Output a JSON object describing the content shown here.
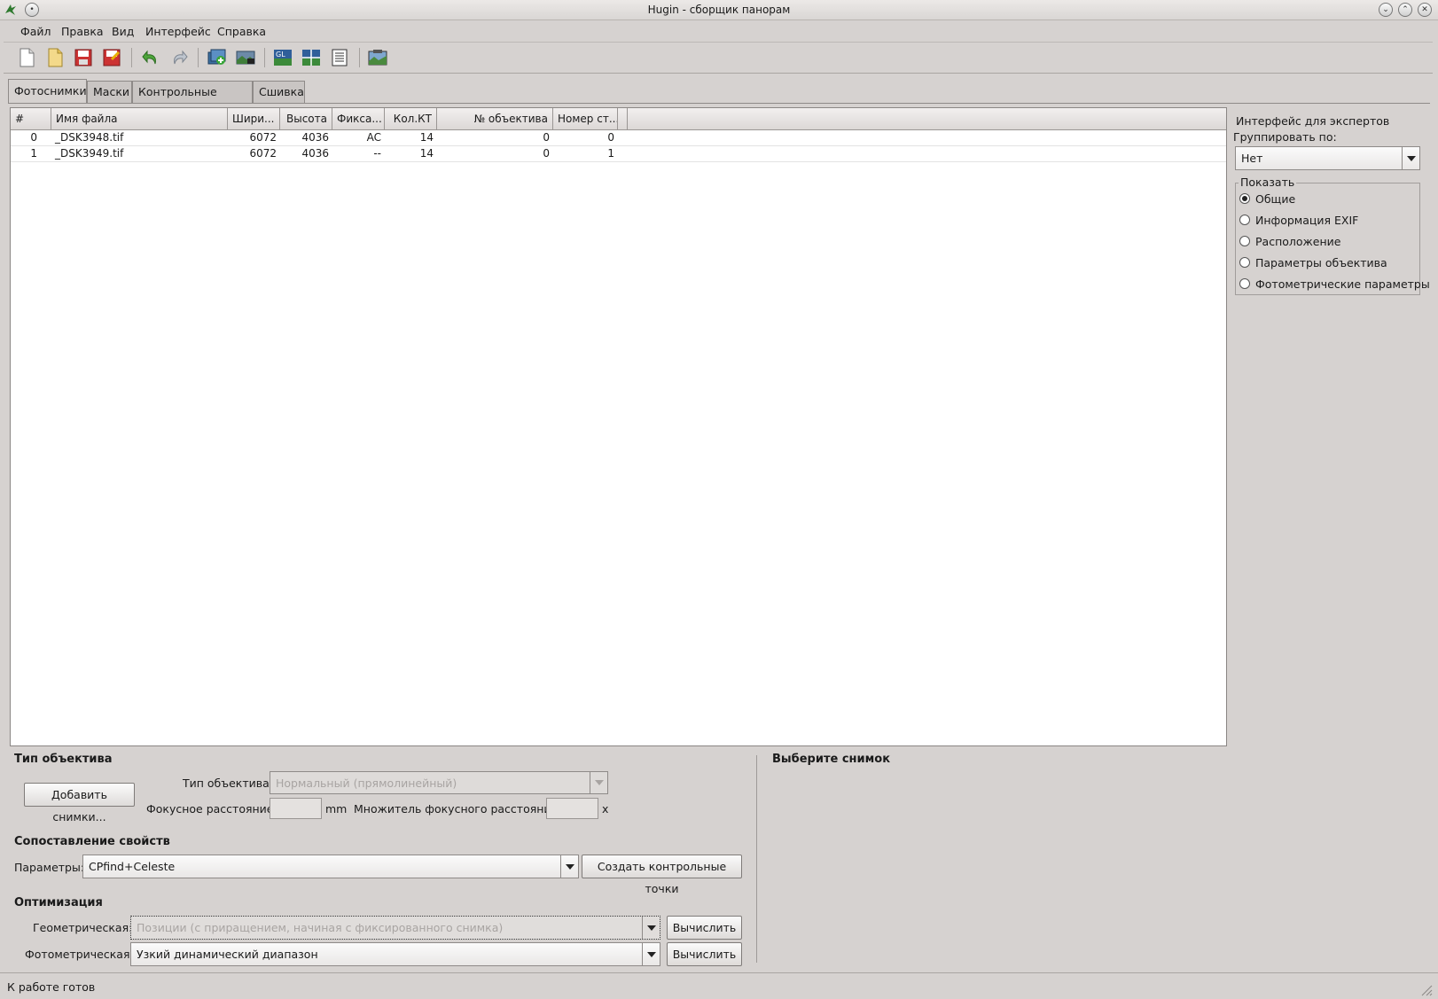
{
  "window": {
    "title": "Hugin - сборщик панорам"
  },
  "menu": [
    {
      "label": "Файл"
    },
    {
      "label": "Правка"
    },
    {
      "label": "Вид"
    },
    {
      "label": "Интерфейс"
    },
    {
      "label": "Справка"
    }
  ],
  "toolbar": {
    "icons": [
      "new-document-icon",
      "open-icon",
      "save-icon",
      "save-as-icon",
      "undo-icon",
      "redo-icon",
      "add-images-icon",
      "assistant-icon",
      "gl-preview-icon",
      "fast-preview-icon",
      "layout-icon",
      "stitch-icon"
    ]
  },
  "tabs": [
    {
      "label": "Фотоснимки",
      "active": true
    },
    {
      "label": "Маски"
    },
    {
      "label": "Контрольные точки"
    },
    {
      "label": "Сшивка"
    }
  ],
  "table": {
    "columns": [
      "#",
      "Имя файла",
      "Шири...",
      "Высота",
      "Фикса...",
      "Кол.КТ",
      "№ объектива",
      "Номер ст..."
    ],
    "rows": [
      [
        "0",
        "_DSK3948.tif",
        "6072",
        "4036",
        "AC",
        "14",
        "0",
        "0"
      ],
      [
        "1",
        "_DSK3949.tif",
        "6072",
        "4036",
        "--",
        "14",
        "0",
        "1"
      ]
    ]
  },
  "right_panel": {
    "expert_label": "Интерфейс для экспертов",
    "group_by_label": "Группировать по:",
    "group_by_value": "Нет",
    "show_label": "Показать",
    "options": [
      {
        "label": "Общие",
        "selected": true
      },
      {
        "label": "Информация EXIF"
      },
      {
        "label": "Расположение"
      },
      {
        "label": "Параметры объектива"
      },
      {
        "label": "Фотометрические параметры"
      }
    ]
  },
  "lens": {
    "section_title": "Тип объектива",
    "add_images_button": "Добавить снимки...",
    "lens_type_label": "Тип объектива:",
    "lens_type_value": "Нормальный (прямолинейный)",
    "focal_label": "Фокусное расстояние:",
    "focal_value": "",
    "focal_unit": "mm",
    "crop_label": "Множитель фокусного расстояния:",
    "crop_value": "",
    "crop_unit": "x"
  },
  "preview": {
    "title": "Выберите снимок"
  },
  "features": {
    "section_title": "Сопоставление свойств",
    "params_label": "Параметры:",
    "params_value": "CPfind+Celeste",
    "create_button": "Создать контрольные точки"
  },
  "optimize": {
    "section_title": "Оптимизация",
    "geom_label": "Геометрическая:",
    "geom_value": "Позиции (с приращением, начиная с фиксированного снимка)",
    "geom_button": "Вычислить",
    "photo_label": "Фотометрическая:",
    "photo_value": "Узкий динамический диапазон",
    "photo_button": "Вычислить"
  },
  "status": {
    "text": "К работе готов"
  },
  "colors": {
    "background": "#d6d2d0",
    "list_bg": "#ffffff",
    "accent": "#3a7bd5"
  }
}
